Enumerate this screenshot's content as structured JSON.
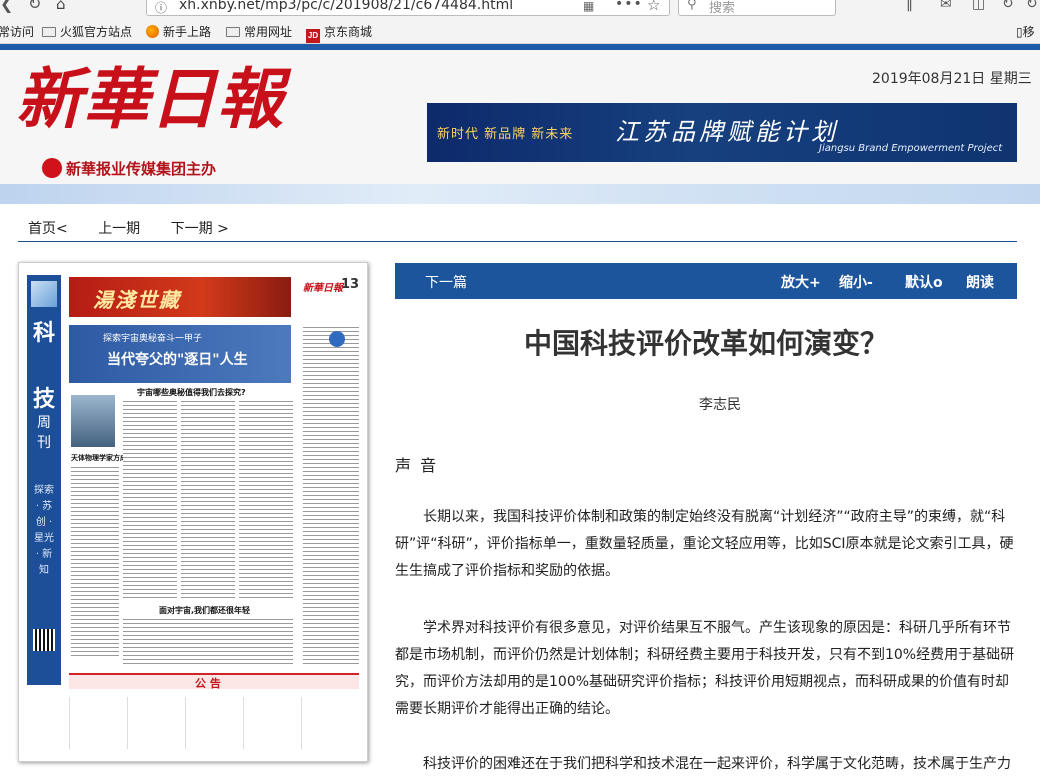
{
  "browser": {
    "url": "xh.xnby.net/mp3/pc/c/201908/21/c674484.html",
    "search_placeholder": "搜索",
    "bookmarks": [
      {
        "label": "常访问",
        "icon": "none"
      },
      {
        "label": "火狐官方站点",
        "icon": "folder-icon"
      },
      {
        "label": "新手上路",
        "icon": "firefox-icon"
      },
      {
        "label": "常用网址",
        "icon": "folder-icon"
      },
      {
        "label": "京东商城",
        "icon": "jd-icon"
      },
      {
        "label": "移",
        "icon": "phone-icon"
      }
    ]
  },
  "masthead": {
    "logo": "新華日報",
    "org": "新華报业传媒集团主办",
    "date": "2019年08月21日 星期三",
    "banner_left": "新时代  新品牌  新未来",
    "banner_center": "江苏品牌赋能计划",
    "banner_right": "Jiangsu Brand Empowerment Project"
  },
  "page_nav": {
    "home": "首页<",
    "prev": "上一期",
    "next": "下一期  >"
  },
  "thumbnail": {
    "side_title_1": "科",
    "side_title_2": "技",
    "side_weekly": "周刊",
    "side_sub": "探索 · 苏创 · 星光 · 新知",
    "ad_text": "湯淺世藏",
    "mini_logo": "新華日報",
    "page_number": "13",
    "hero_kicker": "探索宇宙奥秘奋斗一甲子",
    "hero_title": "当代夸父的\"逐日\"人生",
    "headline_1": "宇宙哪些奥秘值得我们去探究?",
    "headline_2": "面对宇宙,我们都还很年轻",
    "photo_caption": "天体物理学家方成院士",
    "notice": "公  告"
  },
  "toolbar": {
    "next_article": "下一篇",
    "zoom_in": "放大+",
    "zoom_out": "缩小-",
    "default": "默认o",
    "read": "朗读"
  },
  "article": {
    "title": "中国科技评价改革如何演变？",
    "author": "李志民",
    "section": "声 音",
    "paragraphs": [
      "长期以来，我国科技评价体制和政策的制定始终没有脱离“计划经济”“政府主导”的束缚，就“科研”评“科研”，评价指标单一，重数量轻质量，重论文轻应用等，比如SCI原本就是论文索引工具，硬生生搞成了评价指标和奖励的依据。",
      "学术界对科技评价有很多意见，对评价结果互不服气。产生该现象的原因是：科研几乎所有环节都是市场机制，而评价仍然是计划体制；科研经费主要用于科技开发，只有不到10%经费用于基础研究，而评价方法却用的是100%基础研究评价指标；科技评价用短期视点，而科研成果的价值有时却需要长期评价才能得出正确的结论。",
      "科技评价的困难还在于我们把科学和技术混在一起来评价，科学属于文化范畴，技术属于生产力"
    ]
  },
  "colors": {
    "brand_blue": "#1c559c",
    "logo_red": "#c8101a"
  }
}
